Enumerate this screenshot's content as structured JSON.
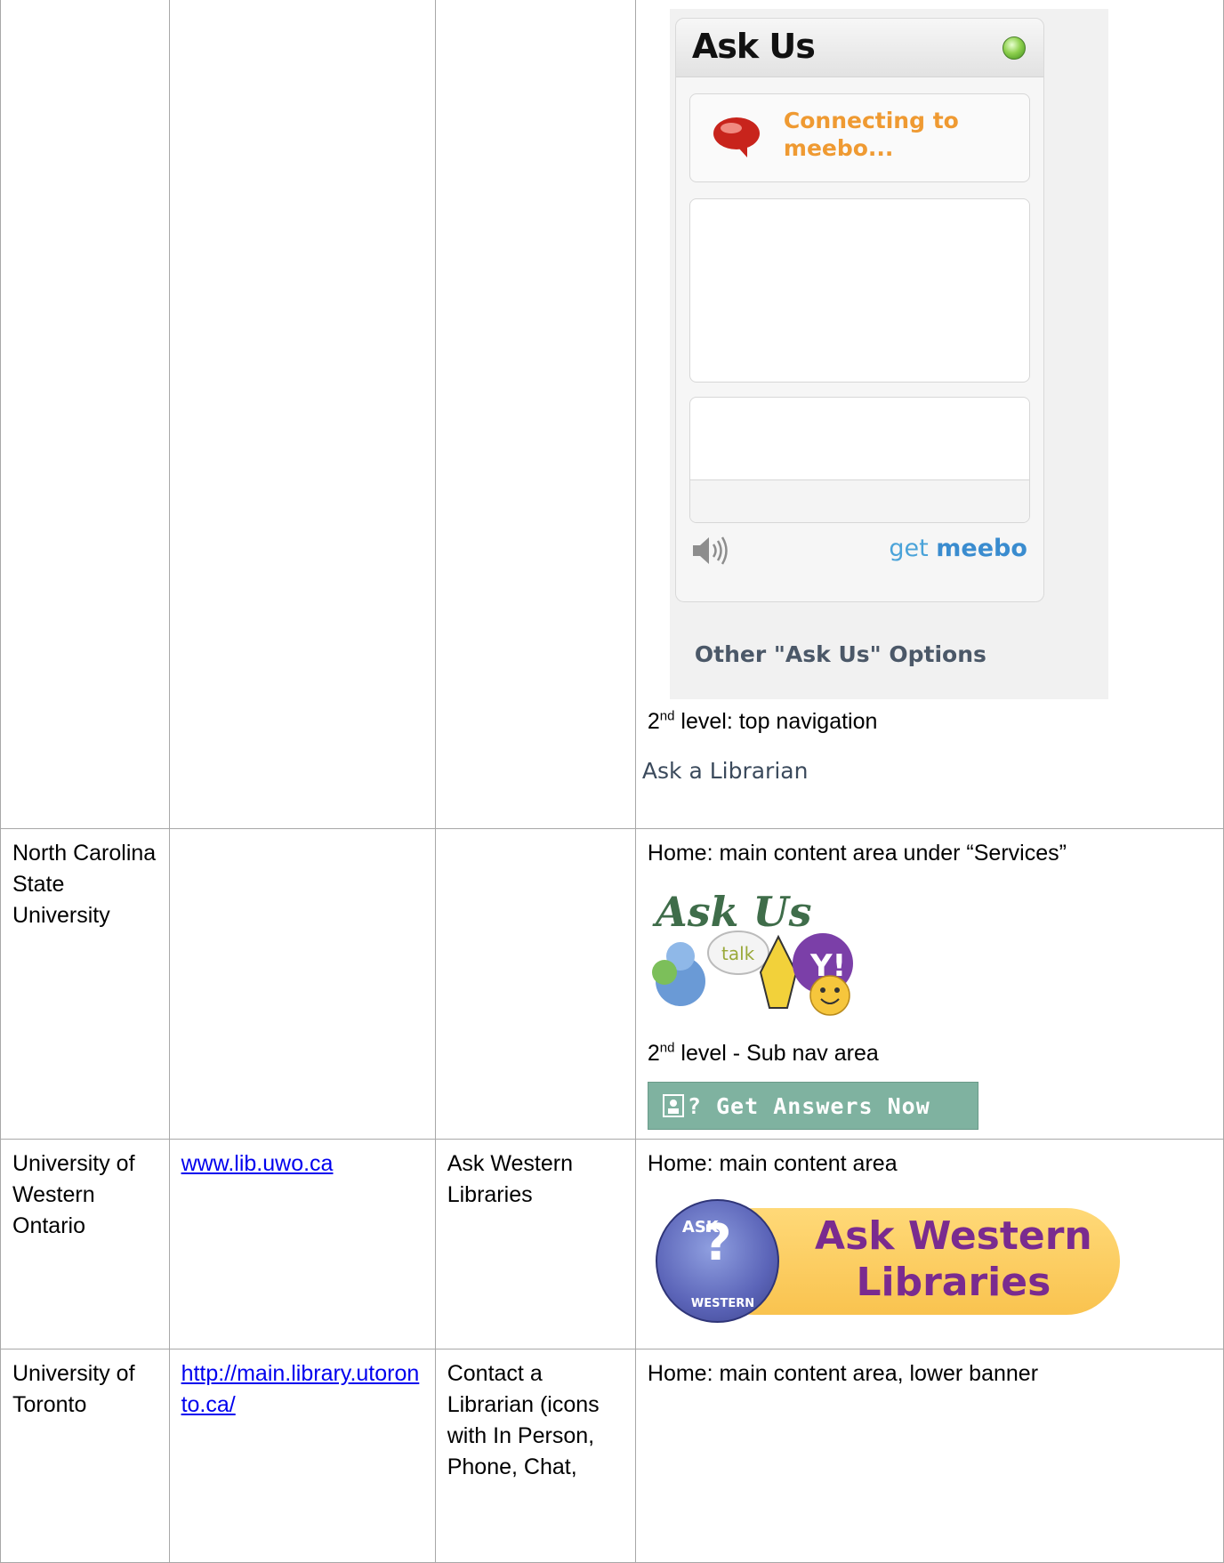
{
  "rows": [
    {
      "institution": "",
      "url": "",
      "label": "",
      "widget": {
        "title": "Ask Us",
        "connecting": "Connecting to meebo...",
        "get": "get",
        "meebo": "meebo",
        "other_options": "Other \"Ask Us\" Options"
      },
      "level_prefix": "2",
      "level_sup": "nd",
      "level_text": " level: top navigation",
      "ask_librarian": "Ask a Librarian"
    },
    {
      "institution": "North Carolina State University",
      "url": "",
      "label": "",
      "home_text": "Home: main content area under “Services”",
      "logo_text": "Ask Us",
      "logo_talk": "talk",
      "level_prefix": "2",
      "level_sup": "nd",
      "level_text": " level - Sub nav area",
      "button_text": "? Get Answers Now"
    },
    {
      "institution": "University of Western Ontario",
      "url": "www.lib.uwo.ca",
      "label": "Ask Western Libraries",
      "home_text": "Home: main content area",
      "banner_text": "Ask Western Libraries",
      "disc_top": "ASK",
      "disc_bottom": "WESTERN",
      "disc_mark": "?"
    },
    {
      "institution": "University of Toronto",
      "url": "http://main.library.utoronto.ca/",
      "label": "Contact a Librarian (icons with In Person, Phone, Chat,",
      "home_text": "Home: main content area, lower banner"
    }
  ],
  "colors": {
    "border": "#a8a8a8",
    "link": "#0000ee",
    "meebo_orange": "#ef9a32",
    "ncsu_button": "#7fb2a0",
    "western_purple": "#7a2b8f",
    "western_yellow": "#f9c34f"
  }
}
